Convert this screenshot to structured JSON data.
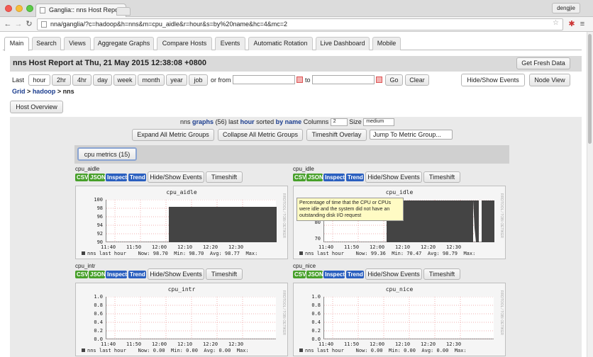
{
  "browser": {
    "tab_title": "Ganglia:: nns Host Report",
    "url": "nna/ganglia/?c=hadoop&h=nns&m=cpu_aidle&r=hour&s=by%20name&hc=4&mc=2",
    "user": "dengjie"
  },
  "nav_tabs": [
    "Main",
    "Search",
    "Views",
    "Aggregate Graphs",
    "Compare Hosts",
    "Events",
    "Automatic Rotation",
    "Live Dashboard",
    "Mobile"
  ],
  "active_tab": "Main",
  "page_title": "nns Host Report at Thu, 21 May 2015 12:38:08 +0800",
  "get_fresh_data": "Get Fresh Data",
  "range": {
    "last_label": "Last",
    "options": [
      "hour",
      "2hr",
      "4hr",
      "day",
      "week",
      "month",
      "year",
      "job"
    ],
    "selected": "hour",
    "or_from": "or from",
    "to": "to",
    "go": "Go",
    "clear": "Clear"
  },
  "hide_show_events": "Hide/Show Events",
  "node_view": "Node View",
  "breadcrumb": {
    "grid": "Grid",
    "sep1": ">",
    "cluster": "hadoop",
    "sep2": ">",
    "host": "nns"
  },
  "host_overview": "Host Overview",
  "summary": {
    "pre": "nns",
    "graphs_word": "graphs",
    "count": "(56)",
    "last_word": "last",
    "range": "hour",
    "sorted": "sorted",
    "by_name": "by name",
    "columns_label": "Columns",
    "columns_value": "2",
    "size_label": "Size",
    "size_value": "medium"
  },
  "group_buttons": {
    "expand": "Expand All Metric Groups",
    "collapse": "Collapse All Metric Groups",
    "timeshift": "Timeshift Overlay",
    "jump": "Jump To Metric Group..."
  },
  "metric_group": "cpu metrics (15)",
  "tooltip": "Percentage of time that the CPU or CPUs were idle and the system did not have an outstanding disk I/O request",
  "metrics": [
    {
      "name": "cpu_aidle",
      "badges": [
        "CSV",
        "JSON",
        "Inspect",
        "Trend"
      ],
      "events": "Hide/Show Events",
      "timeshift": "Timeshift",
      "title": "cpu_aidle",
      "yticks": [
        "100",
        "98",
        "96",
        "94",
        "92",
        "90"
      ],
      "xticks": [
        "11:40",
        "11:50",
        "12:00",
        "12:10",
        "12:20",
        "12:30"
      ],
      "legend": {
        "label": "nns last hour",
        "now": "Now:",
        "now_v": "98.70",
        "min": "Min:",
        "min_v": "98.70",
        "avg": "Avg:",
        "avg_v": "98.77",
        "max": "Max:"
      }
    },
    {
      "name": "cpu_idle",
      "badges": [
        "CSV",
        "JSON",
        "Inspect",
        "Trend"
      ],
      "events": "Hide/Show Events",
      "timeshift": "Timeshift",
      "title": "cpu_idle",
      "yticks": [
        "90",
        "80",
        "70"
      ],
      "xticks": [
        "11:40",
        "11:50",
        "12:00",
        "12:10",
        "12:20",
        "12:30"
      ],
      "legend": {
        "label": "nns last hour",
        "now": "Now:",
        "now_v": "99.36",
        "min": "Min:",
        "min_v": "70.47",
        "avg": "Avg:",
        "avg_v": "98.79",
        "max": "Max:"
      }
    },
    {
      "name": "cpu_intr",
      "badges": [
        "CSV",
        "JSON",
        "Inspect",
        "Trend"
      ],
      "events": "Hide/Show Events",
      "timeshift": "Timeshift",
      "title": "cpu_intr",
      "yticks": [
        "1.0",
        "0.8",
        "0.6",
        "0.4",
        "0.2",
        "0.0"
      ],
      "xticks": [
        "11:40",
        "11:50",
        "12:00",
        "12:10",
        "12:20",
        "12:30"
      ],
      "legend": {
        "label": "nns last hour",
        "now": "Now:",
        "now_v": "0.00",
        "min": "Min:",
        "min_v": "0.00",
        "avg": "Avg:",
        "avg_v": "0.00",
        "max": "Max:"
      }
    },
    {
      "name": "cpu_nice",
      "badges": [
        "CSV",
        "JSON",
        "Inspect",
        "Trend"
      ],
      "events": "Hide/Show Events",
      "timeshift": "Timeshift",
      "title": "cpu_nice",
      "yticks": [
        "1.0",
        "0.8",
        "0.6",
        "0.4",
        "0.2",
        "0.0"
      ],
      "xticks": [
        "11:40",
        "11:50",
        "12:00",
        "12:10",
        "12:20",
        "12:30"
      ],
      "legend": {
        "label": "nns last hour",
        "now": "Now:",
        "now_v": "0.00",
        "min": "Min:",
        "min_v": "0.00",
        "avg": "Avg:",
        "avg_v": "0.00",
        "max": "Max:"
      }
    }
  ],
  "rrd_watermark": "RRDTOOL / TOBI OETIKER"
}
